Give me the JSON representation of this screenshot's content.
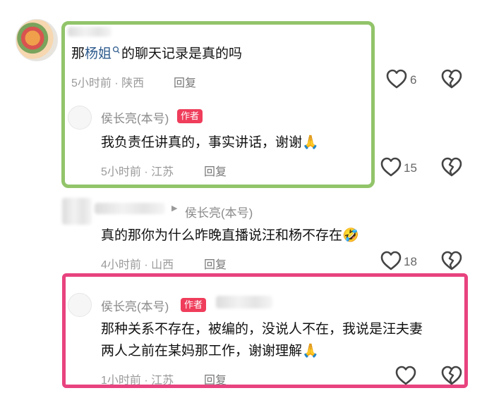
{
  "comments": [
    {
      "prefix": "那",
      "link": "杨姐",
      "suffix": "的聊天记录是真的吗",
      "time": "5小时前",
      "location": "陕西",
      "reply_label": "回复",
      "likes": "6",
      "replies": [
        {
          "author": "侯长亮(本号)",
          "badge": "作者",
          "text": "我负责任讲真的，事实讲话，谢谢🙏",
          "time": "5小时前",
          "location": "江苏",
          "reply_label": "回复",
          "likes": "15"
        },
        {
          "reply_to": "侯长亮(本号)",
          "text": "真的那你为什么昨晚直播说汪和杨不存在🤣",
          "time": "4小时前",
          "location": "山西",
          "reply_label": "回复",
          "likes": "18"
        },
        {
          "author": "侯长亮(本号)",
          "badge": "作者",
          "text_line1": "那种关系不存在，被编的，没说人不在，我说是汪夫妻",
          "text_line2": "两人之前在某妈那工作，谢谢理解🙏",
          "time": "1小时前",
          "location": "江苏",
          "reply_label": "回复"
        }
      ]
    }
  ],
  "separator": " · ",
  "reply_arrow": "▶",
  "colors": {
    "highlight_green": "#92c46a",
    "highlight_pink": "#e8437f",
    "author_badge": "#ef3d5b"
  },
  "icons": [
    "heart-outline-icon",
    "broken-heart-icon",
    "search-link-icon",
    "praying-hands-emoji",
    "rolling-laughing-emoji"
  ]
}
